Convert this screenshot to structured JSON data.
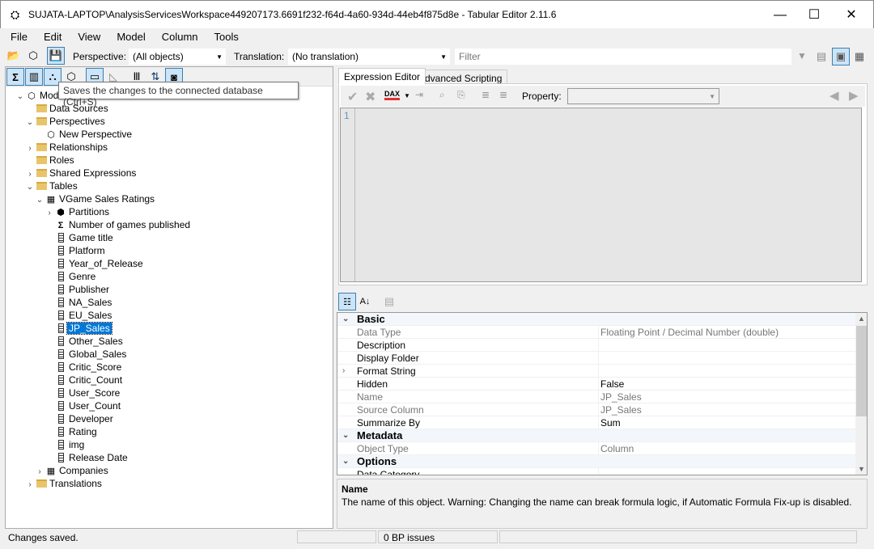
{
  "window": {
    "title": "SUJATA-LAPTOP\\AnalysisServicesWorkspace449207173.6691f232-f64d-4a60-934d-44eb4f875d8e - Tabular Editor 2.11.6",
    "minimize": "—",
    "maximize": "☐",
    "close": "✕"
  },
  "menu": [
    "File",
    "Edit",
    "View",
    "Model",
    "Column",
    "Tools"
  ],
  "toolbar": {
    "perspective_label": "Perspective:",
    "perspective_value": "(All objects)",
    "translation_label": "Translation:",
    "translation_value": "(No translation)",
    "filter_placeholder": "Filter"
  },
  "tooltip": "Saves the changes to the connected database (Ctrl+S)",
  "tree": [
    {
      "label": "Model",
      "depth": 0,
      "exp": "open",
      "icon": "cube"
    },
    {
      "label": "Data Sources",
      "depth": 1,
      "exp": "none",
      "icon": "folder"
    },
    {
      "label": "Perspectives",
      "depth": 1,
      "exp": "open",
      "icon": "folder"
    },
    {
      "label": "New Perspective",
      "depth": 2,
      "exp": "none",
      "icon": "perspective"
    },
    {
      "label": "Relationships",
      "depth": 1,
      "exp": "closed",
      "icon": "folder"
    },
    {
      "label": "Roles",
      "depth": 1,
      "exp": "none",
      "icon": "folder"
    },
    {
      "label": "Shared Expressions",
      "depth": 1,
      "exp": "closed",
      "icon": "folder"
    },
    {
      "label": "Tables",
      "depth": 1,
      "exp": "open",
      "icon": "folder"
    },
    {
      "label": "VGame Sales Ratings",
      "depth": 2,
      "exp": "open",
      "icon": "table"
    },
    {
      "label": "Partitions",
      "depth": 3,
      "exp": "closed",
      "icon": "partition"
    },
    {
      "label": "Number of games published",
      "depth": 3,
      "exp": "none",
      "icon": "measure"
    },
    {
      "label": "Game title",
      "depth": 3,
      "exp": "none",
      "icon": "column"
    },
    {
      "label": "Platform",
      "depth": 3,
      "exp": "none",
      "icon": "column"
    },
    {
      "label": "Year_of_Release",
      "depth": 3,
      "exp": "none",
      "icon": "column"
    },
    {
      "label": "Genre",
      "depth": 3,
      "exp": "none",
      "icon": "column"
    },
    {
      "label": "Publisher",
      "depth": 3,
      "exp": "none",
      "icon": "column"
    },
    {
      "label": "NA_Sales",
      "depth": 3,
      "exp": "none",
      "icon": "column"
    },
    {
      "label": "EU_Sales",
      "depth": 3,
      "exp": "none",
      "icon": "column"
    },
    {
      "label": "JP_Sales",
      "depth": 3,
      "exp": "none",
      "icon": "column",
      "selected": true
    },
    {
      "label": "Other_Sales",
      "depth": 3,
      "exp": "none",
      "icon": "column"
    },
    {
      "label": "Global_Sales",
      "depth": 3,
      "exp": "none",
      "icon": "column"
    },
    {
      "label": "Critic_Score",
      "depth": 3,
      "exp": "none",
      "icon": "column"
    },
    {
      "label": "Critic_Count",
      "depth": 3,
      "exp": "none",
      "icon": "column"
    },
    {
      "label": "User_Score",
      "depth": 3,
      "exp": "none",
      "icon": "column"
    },
    {
      "label": "User_Count",
      "depth": 3,
      "exp": "none",
      "icon": "column"
    },
    {
      "label": "Developer",
      "depth": 3,
      "exp": "none",
      "icon": "column"
    },
    {
      "label": "Rating",
      "depth": 3,
      "exp": "none",
      "icon": "column"
    },
    {
      "label": "img",
      "depth": 3,
      "exp": "none",
      "icon": "column"
    },
    {
      "label": "Release Date",
      "depth": 3,
      "exp": "none",
      "icon": "column"
    },
    {
      "label": "Companies",
      "depth": 2,
      "exp": "closed",
      "icon": "table"
    },
    {
      "label": "Translations",
      "depth": 1,
      "exp": "closed",
      "icon": "folder"
    }
  ],
  "tabs": [
    "Expression Editor",
    "Advanced Scripting"
  ],
  "editor": {
    "property_label": "Property:",
    "property_value": "",
    "line_number": "1",
    "dax_label": "DAX"
  },
  "properties": [
    {
      "cat": true,
      "name": "Basic"
    },
    {
      "name": "Data Type",
      "value": "Floating Point / Decimal Number (double)",
      "readonly": true
    },
    {
      "name": "Description",
      "value": ""
    },
    {
      "name": "Display Folder",
      "value": ""
    },
    {
      "name": "Format String",
      "value": "",
      "expandable": true
    },
    {
      "name": "Hidden",
      "value": "False"
    },
    {
      "name": "Name",
      "value": "JP_Sales",
      "readonly": true
    },
    {
      "name": "Source Column",
      "value": "JP_Sales",
      "readonly": true
    },
    {
      "name": "Summarize By",
      "value": "Sum"
    },
    {
      "cat": true,
      "name": "Metadata"
    },
    {
      "name": "Object Type",
      "value": "Column",
      "readonly": true
    },
    {
      "cat": true,
      "name": "Options"
    },
    {
      "name": "Data Category",
      "value": ""
    }
  ],
  "description": {
    "title": "Name",
    "text": "The name of this object. Warning: Changing the name can break formula logic, if Automatic Formula Fix-up is disabled."
  },
  "status": {
    "message": "Changes saved.",
    "bp_issues": "0 BP issues"
  },
  "colors": {
    "selection": "#0078d7",
    "accent": "#3c7fb1"
  }
}
